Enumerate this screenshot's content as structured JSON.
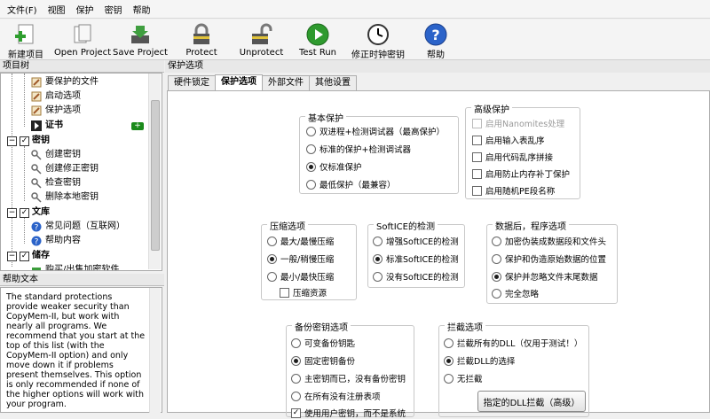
{
  "menu": [
    "文件(F)",
    "视图",
    "保护",
    "密钥",
    "帮助"
  ],
  "toolbar": [
    {
      "label": "新建项目",
      "icon": "new-project-icon"
    },
    {
      "label": "Open Project",
      "icon": "open-project-icon"
    },
    {
      "label": "Save Project",
      "icon": "save-project-icon"
    },
    {
      "label": "Protect",
      "icon": "lock-icon"
    },
    {
      "label": "Unprotect",
      "icon": "unlock-icon"
    },
    {
      "label": "Test Run",
      "icon": "play-icon"
    },
    {
      "label": "修正时钟密钥",
      "icon": "clock-icon"
    },
    {
      "label": "帮助",
      "icon": "help-icon"
    }
  ],
  "left": {
    "tree_title": "项目树",
    "items": [
      "要保护的文件",
      "启动选项",
      "保护选项",
      "证书",
      "密钥",
      "创建密钥",
      "创建修正密钥",
      "检查密钥",
      "删除本地密钥",
      "文库",
      "常见问题（互联网）",
      "帮助内容",
      "储存",
      "购买/出售加密软件"
    ],
    "help_title": "帮助文本",
    "help_text": "The standard protections provide weaker security than CopyMem-II, but work with nearly all programs. We recommend that you start at the top of this list (with the CopyMem-II option) and only move down it if problems present themselves. This option is only recommended if none of the higher options will work with your program."
  },
  "right": {
    "title": "保护选项",
    "tabs": [
      "硬件锁定",
      "保护选项",
      "外部文件",
      "其他设置"
    ],
    "basic": {
      "title": "基本保护",
      "options": [
        "双进程+检测调试器（最高保护）",
        "标准的保护+检测调试器",
        "仅标准保护",
        "最低保护（最兼容）"
      ],
      "selected": 2
    },
    "advanced": {
      "title": "高级保护",
      "options": [
        "启用Nanomites处理",
        "启用输入表乱序",
        "启用代码乱序拼接",
        "启用防止内存补丁保护",
        "启用随机PE段名称"
      ]
    },
    "compress": {
      "title": "压缩选项",
      "options": [
        "最大/最慢压缩",
        "一般/稍慢压缩",
        "最小/最快压缩"
      ],
      "selected": 1,
      "check": "压缩资源"
    },
    "softice": {
      "title": "SoftICE的检测",
      "options": [
        "增强SoftICE的检测",
        "标准SoftICE的检测",
        "没有SoftICE的检测"
      ],
      "selected": 1
    },
    "data": {
      "title": "数据后，程序选项",
      "options": [
        "加密伪装成数据段和文件头",
        "保护和伪造原始数据的位置",
        "保护并忽略文件末尾数据",
        "完全忽略"
      ],
      "selected": 2
    },
    "backup": {
      "title": "备份密钥选项",
      "options": [
        "可变备份钥匙",
        "固定密钥备份",
        "主密钥而已，没有备份密钥",
        "在所有没有注册表项"
      ],
      "selected": 1,
      "check": "使用用户密钥，而不是系统"
    },
    "intercept": {
      "title": "拦截选项",
      "options": [
        "拦截所有的DLL（仅用于测试！）",
        "拦截DLL的选择",
        "无拦截"
      ],
      "selected": 1,
      "button": "指定的DLL拦截（高级）"
    }
  }
}
